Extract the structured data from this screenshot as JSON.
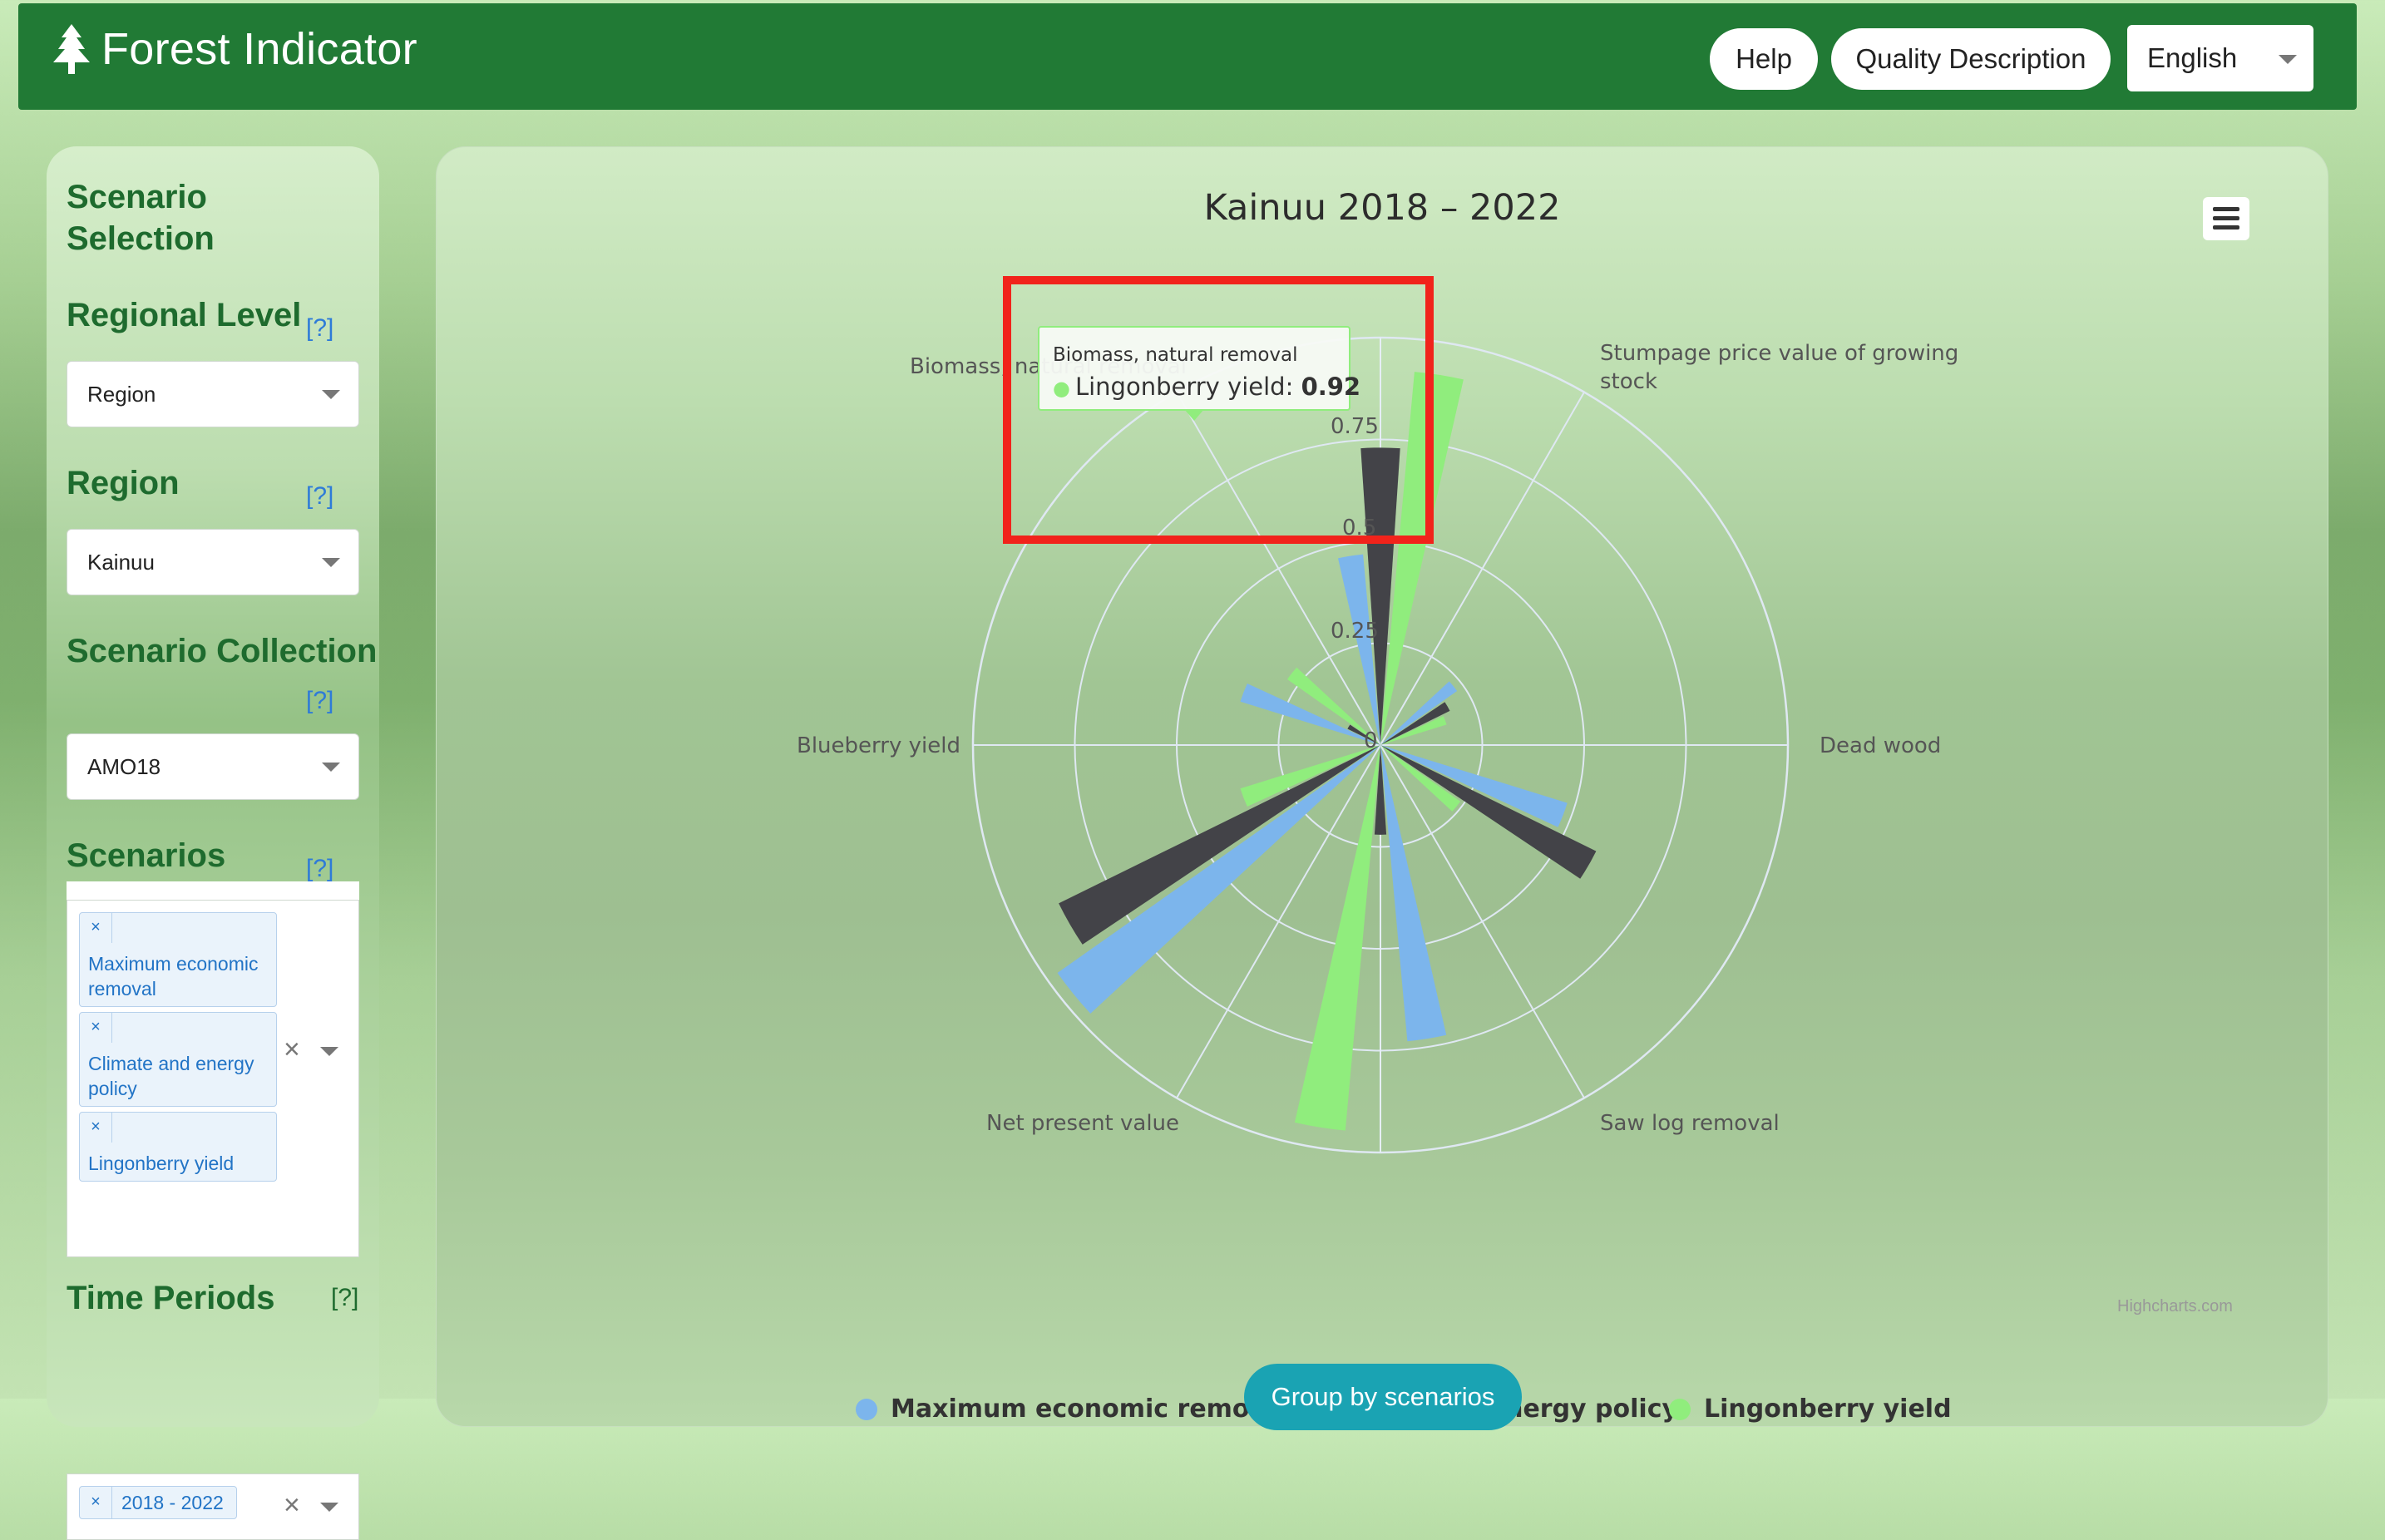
{
  "app": {
    "title": "Forest Indicator",
    "help_label": "Help",
    "quality_label": "Quality Description",
    "language": "English"
  },
  "sidebar": {
    "heading_line1": "Scenario",
    "heading_line2": "Selection",
    "help_text": "[?]",
    "regional_level": {
      "label": "Regional Level",
      "value": "Region"
    },
    "region": {
      "label": "Region",
      "value": "Kainuu"
    },
    "collection": {
      "label": "Scenario Collection",
      "value": "AMO18"
    },
    "scenarios": {
      "label": "Scenarios",
      "chips": [
        "Maximum economic removal",
        "Climate and energy policy",
        "Lingonberry yield"
      ],
      "chip_lines": [
        [
          "Maximum economic",
          "removal"
        ],
        [
          "Climate and energy",
          "policy"
        ],
        [
          "Lingonberry yield"
        ]
      ],
      "remove": "×",
      "clear": "×"
    },
    "time_periods": {
      "label": "Time Periods",
      "chip": "2018 - 2022"
    }
  },
  "chart_data": {
    "type": "polar-column",
    "title": "Kainuu 2018 – 2022",
    "categories": [
      "Biomass, natural removal",
      "Stumpage price value of growing stock",
      "Dead wood",
      "Saw log removal",
      "Net present value",
      "Blueberry yield"
    ],
    "radial_ticks": [
      "0",
      "0.25",
      "0.5",
      "0.75"
    ],
    "ylim": [
      0,
      1
    ],
    "series": [
      {
        "name": "Maximum economic removal",
        "color": "#7cb5ec",
        "values": [
          0.47,
          0.23,
          0.48,
          0.73,
          0.97,
          0.36
        ]
      },
      {
        "name": "Climate and energy policy",
        "color": "#434348",
        "values": [
          0.73,
          0.19,
          0.59,
          0.22,
          0.88,
          0.09
        ]
      },
      {
        "name": "Lingonberry yield",
        "color": "#90ed7d",
        "values": [
          0.92,
          0.17,
          0.24,
          0.95,
          0.36,
          0.28
        ]
      }
    ],
    "legend_position": "bottom-center",
    "credits": "Highcharts.com"
  },
  "tooltip": {
    "category": "Biomass, natural removal",
    "series": "Lingonberry yield",
    "value_prefix": "Lingonberry yield: ",
    "value": "0.92"
  },
  "actions": {
    "group_by": "Group by scenarios"
  }
}
